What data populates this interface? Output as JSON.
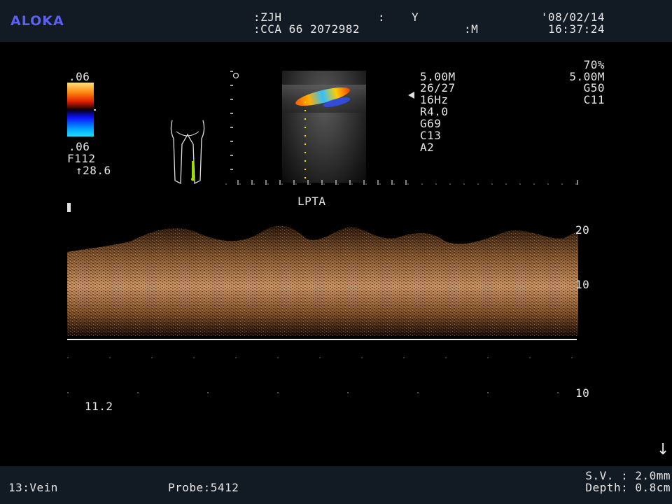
{
  "colors": {
    "header_bg": "#121a24",
    "brand": "#5b5ff2",
    "text": "#e8e8e8",
    "spectrum": "#b07840"
  },
  "header": {
    "brand": "ALOKA",
    "patient_name": ":ZJH",
    "sep_colon": ":",
    "sex": "Y",
    "patient_id": ":CCA 66 2072982",
    "age_unit": ":M",
    "date": "'08/02/14",
    "time": "16:37:24"
  },
  "color_scale": {
    "top_value": ".06",
    "bottom_value": ".06",
    "filter": "F112",
    "angle": "↑28.6"
  },
  "params_left": {
    "freq": "5.00M",
    "frame": "26/27",
    "prf": "16Hz",
    "rej": "R4.0",
    "gain": "G69",
    "contrast": "C13",
    "angle": "A2"
  },
  "params_right": {
    "power": "70%",
    "freq": "5.00M",
    "gain": "G50",
    "contrast": "C11"
  },
  "doppler": {
    "label": "LPTA",
    "scale_labels": [
      "20",
      "10",
      "10"
    ],
    "left_value": "11.2",
    "pulsatile_index": [
      11.2
    ]
  },
  "footer": {
    "preset": "13:Vein",
    "probe": "Probe:5412",
    "sample_volume": "S.V. : 2.0mm",
    "depth": "Depth: 0.8cm"
  },
  "icons": [
    "legs-bodymark-icon",
    "focus-marker-icon",
    "arrow-down-icon",
    "sweep-marker-icon"
  ]
}
